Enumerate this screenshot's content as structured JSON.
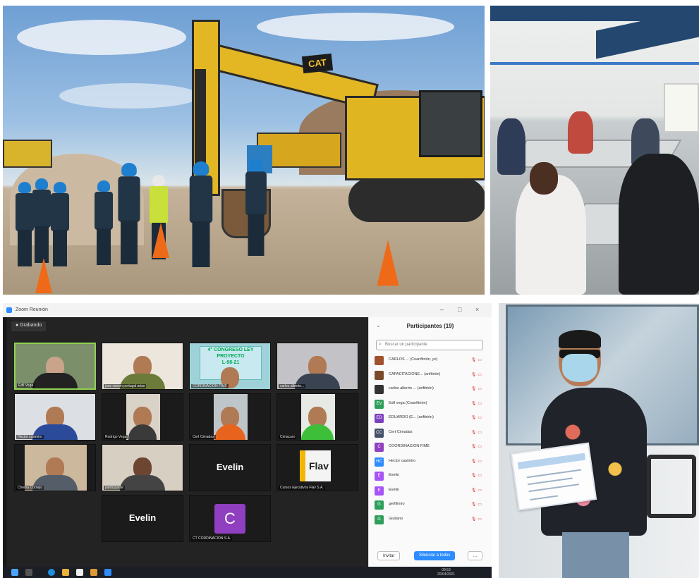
{
  "excavator_photo": {
    "logo_text": "CAT"
  },
  "zoom": {
    "window_title": "Zoom Reunión",
    "recording_chip": "Grabando",
    "tiles": [
      {
        "id": "t1",
        "name": "Edil Vega",
        "kind": "video"
      },
      {
        "id": "t2",
        "name": "jose ramon portugal arias",
        "kind": "video"
      },
      {
        "id": "t3",
        "name": "CORDINACION FIME",
        "kind": "poster",
        "poster_lines": [
          "4° CONGRESO LEY",
          "PROYECTO",
          "L-98-21"
        ]
      },
      {
        "id": "t4",
        "name": "carlos alberto...",
        "kind": "video"
      },
      {
        "id": "t5",
        "name": "Hector casimiro",
        "kind": "video"
      },
      {
        "id": "t6",
        "name": "Rodrigo Vega",
        "kind": "video"
      },
      {
        "id": "t7",
        "name": "Cert Cimadas",
        "kind": "video"
      },
      {
        "id": "t8",
        "name": "Cimacuro",
        "kind": "video"
      },
      {
        "id": "t9",
        "name": "Chema Cornejo",
        "kind": "video"
      },
      {
        "id": "t10",
        "name": "participante",
        "kind": "video"
      },
      {
        "id": "t11",
        "name": "",
        "kind": "name",
        "label": "Evelin"
      },
      {
        "id": "t12",
        "name": "Cursos Ejecutivos Flav S.A.",
        "kind": "logo",
        "label": "Flav"
      },
      {
        "id": "t13",
        "name": "",
        "kind": "name",
        "label": "Evelin"
      },
      {
        "id": "t14",
        "name": "CT CORDINACION S.A.",
        "kind": "avatar",
        "label": "C"
      }
    ],
    "participants_panel": {
      "title": "Participantes (19)",
      "search_placeholder": "Buscar un participante",
      "rows": [
        {
          "name": "CARLOS ... (Coanfitrión, yo)",
          "avatar": "",
          "color": "#a0522d"
        },
        {
          "name": "CAPACITACIONE... (anfitrión)",
          "avatar": "",
          "color": "#7a4b2a"
        },
        {
          "name": "carlos alberto ... (anfitrión)",
          "avatar": "",
          "color": "#333333"
        },
        {
          "name": "Edil vega (Coanfitrión)",
          "avatar": "EV",
          "color": "#2e9e5b"
        },
        {
          "name": "EDUARDO (E... (anfitrión)",
          "avatar": "ED",
          "color": "#7b3fbf"
        },
        {
          "name": "Cert Cimadas",
          "avatar": "CC",
          "color": "#44506a"
        },
        {
          "name": "COORDINACION FIME",
          "avatar": "C",
          "color": "#8f3fbf"
        },
        {
          "name": "Hector casimiro",
          "avatar": "HC",
          "color": "#2d8cff"
        },
        {
          "name": "Evelin",
          "avatar": "E",
          "color": "#a855f7"
        },
        {
          "name": "Evelin",
          "avatar": "E",
          "color": "#a855f7"
        },
        {
          "name": "gerfilmiro",
          "avatar": "G",
          "color": "#2e9e5b"
        },
        {
          "name": "Giuliano",
          "avatar": "G",
          "color": "#2e9e5b"
        }
      ],
      "invite_label": "Invitar",
      "mute_all_label": "Silenciar a todos",
      "more_label": "..."
    },
    "taskbar_time": "09:53",
    "taskbar_date": "20/04/2021"
  },
  "certificate_photo": {}
}
